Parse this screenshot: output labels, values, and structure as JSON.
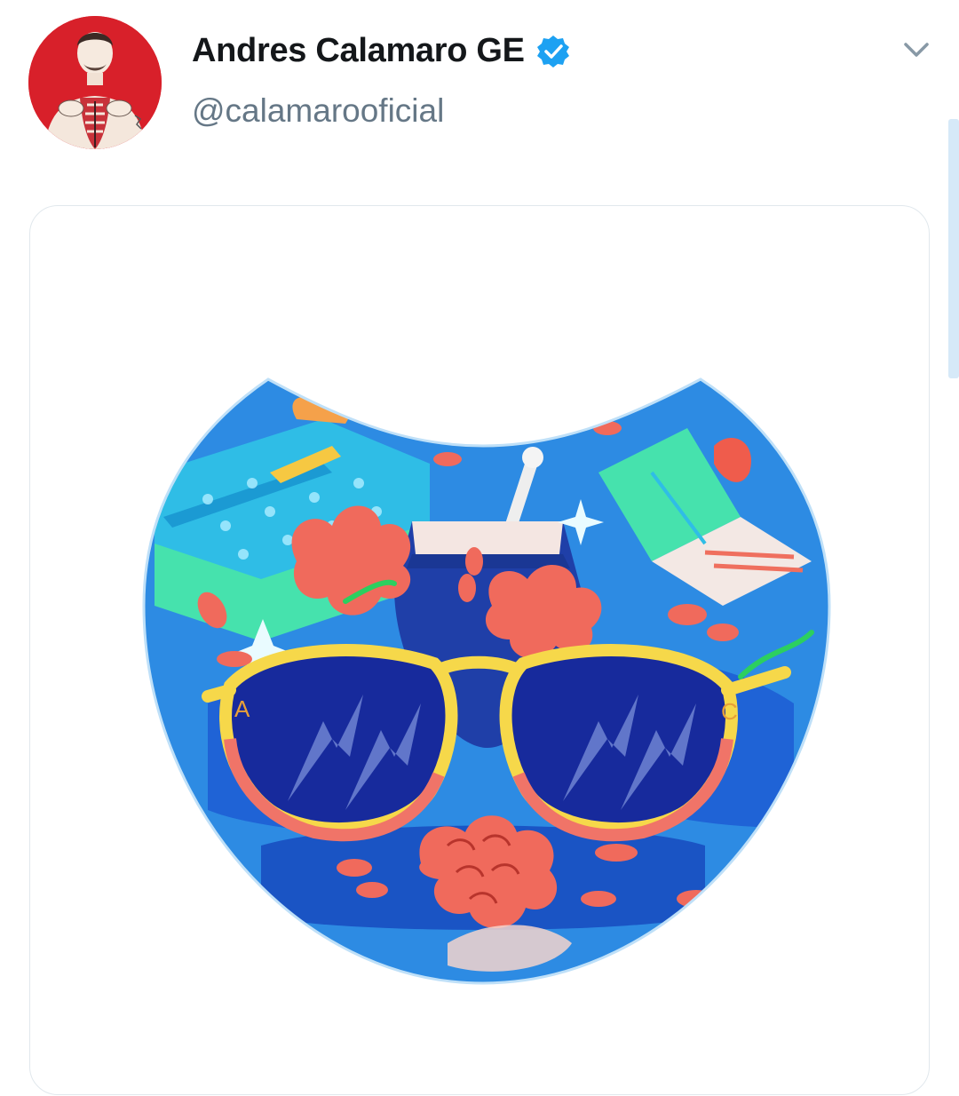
{
  "tweet": {
    "author": {
      "display_name": "Andres Calamaro GE",
      "handle": "@calamarooficial",
      "verified": true,
      "avatar_icon": "illustrated-portrait-avatar"
    },
    "menu_icon": "chevron-down-icon",
    "media": {
      "kind": "illustration",
      "icon": "sunglasses-mate-illustration",
      "letters": [
        "A",
        "C"
      ]
    }
  },
  "colors": {
    "name": "#14171a",
    "handle": "#657786",
    "verified": "#1da1f2",
    "caret": "#8899a6",
    "card_border": "#e1e8ed",
    "scroll": "#d6e9f8"
  }
}
